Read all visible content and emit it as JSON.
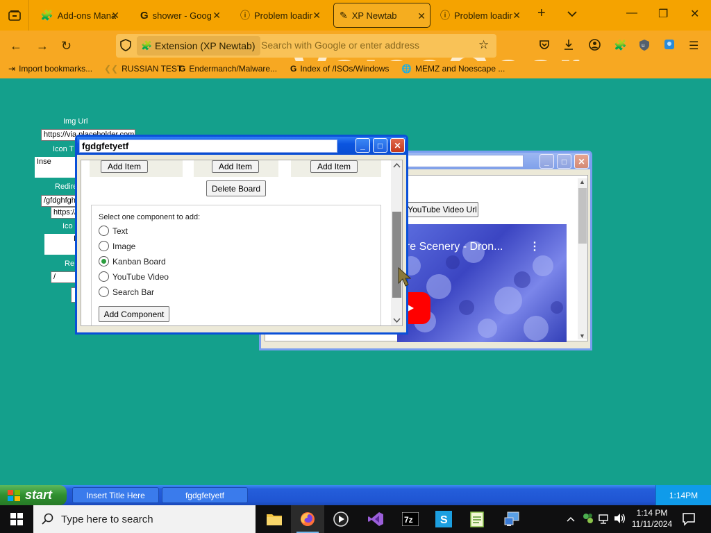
{
  "browser": {
    "tabs": [
      {
        "title": "Add-ons Manager"
      },
      {
        "title": "shower - Google Search"
      },
      {
        "title": "Problem loading page"
      },
      {
        "title": "XP Newtab"
      },
      {
        "title": "Problem loading page"
      }
    ],
    "url_pill": "Extension (XP Newtab)",
    "url_placeholder": "Search with Google or enter address",
    "watermark": "VoiceGear",
    "bookmarks": [
      "Import bookmarks...",
      "RUSSIAN TEST",
      "Endermanch/Malware...",
      "Index of /ISOs/Windows",
      "MEMZ and Noescape ..."
    ]
  },
  "page_form": {
    "img_url_label": "Img Url",
    "img_url_value": "https://via.placeholder.com",
    "icon_title_label": "Icon T",
    "insert_value": "Inse",
    "redirect_label": "Redire",
    "redirect_value": "/gfdghfgh",
    "https_value": "https://",
    "icon_label2": "Ico",
    "icon_input2": "I",
    "re_label": "Re",
    "re_value": "/"
  },
  "back_window": {
    "youtube_button": "YouTube Video Url",
    "video_title": "ure Scenery - Dron..."
  },
  "main_window": {
    "title": "fgdgfetyetf",
    "add_item_label": "Add Item",
    "delete_board": "Delete Board",
    "select_prompt": "Select one component to add:",
    "options": [
      "Text",
      "Image",
      "Kanban Board",
      "YouTube Video",
      "Search Bar"
    ],
    "selected": "Kanban Board",
    "add_component": "Add Component"
  },
  "xp_taskbar": {
    "start": "start",
    "items": [
      "Insert Title Here",
      "fgdgfetyetf"
    ],
    "clock": "1:14PM"
  },
  "win10_taskbar": {
    "search_placeholder": "Type here to search",
    "time": "1:14 PM",
    "date": "11/11/2024"
  },
  "colors": {
    "desktop": "#14a08c",
    "browser_accent": "#f5a300",
    "xp_blue": "#0a50d8"
  }
}
